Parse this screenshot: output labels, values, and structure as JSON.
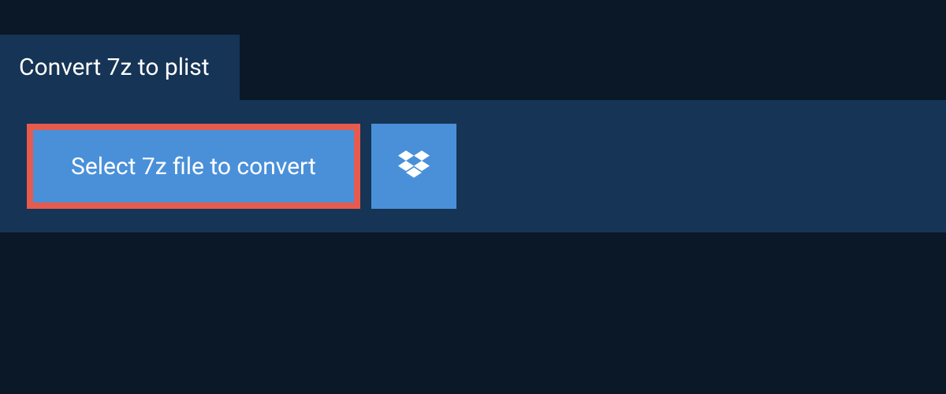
{
  "header": {
    "title": "Convert 7z to plist"
  },
  "actions": {
    "select_label": "Select 7z file to convert",
    "dropbox_icon": "dropbox"
  },
  "colors": {
    "background": "#0a1828",
    "panel": "#163455",
    "button": "#4a90d9",
    "highlight_border": "#e75a4e"
  }
}
